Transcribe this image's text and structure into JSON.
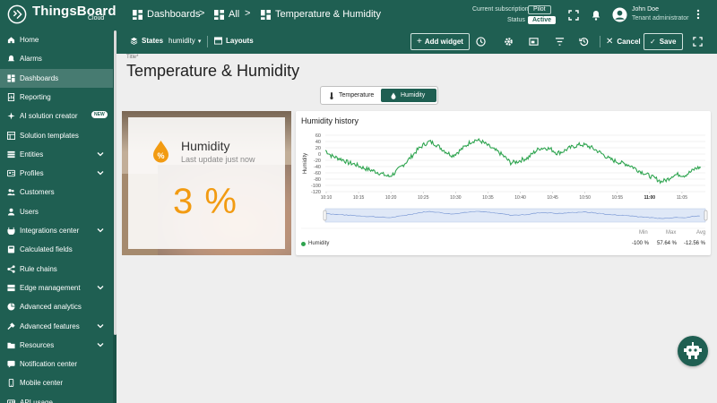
{
  "header": {
    "brand": "ThingsBoard",
    "brand_sub": "Cloud",
    "breadcrumb": [
      "Dashboards",
      "All",
      "Temperature & Humidity"
    ],
    "subscription_label": "Current subscription",
    "subscription_value": "Pilot",
    "status_label": "Status",
    "status_value": "Active",
    "user_name": "John Doe",
    "user_role": "Tenant administrator"
  },
  "sidebar": {
    "items": [
      {
        "label": "Home",
        "icon": "home-icon"
      },
      {
        "label": "Alarms",
        "icon": "alarm-icon"
      },
      {
        "label": "Dashboards",
        "icon": "dashboard-icon",
        "active": true
      },
      {
        "label": "Reporting",
        "icon": "report-icon"
      },
      {
        "label": "AI solution creator",
        "icon": "sparkle-icon",
        "badge": "NEW"
      },
      {
        "label": "Solution templates",
        "icon": "template-icon"
      },
      {
        "label": "Entities",
        "icon": "entities-icon",
        "expandable": true
      },
      {
        "label": "Profiles",
        "icon": "profiles-icon",
        "expandable": true
      },
      {
        "label": "Customers",
        "icon": "customers-icon"
      },
      {
        "label": "Users",
        "icon": "user-icon"
      },
      {
        "label": "Integrations center",
        "icon": "integrations-icon",
        "expandable": true
      },
      {
        "label": "Calculated fields",
        "icon": "calc-icon"
      },
      {
        "label": "Rule chains",
        "icon": "rule-chain-icon"
      },
      {
        "label": "Edge management",
        "icon": "edge-icon",
        "expandable": true
      },
      {
        "label": "Advanced analytics",
        "icon": "analytics-icon"
      },
      {
        "label": "Advanced features",
        "icon": "tools-icon",
        "expandable": true
      },
      {
        "label": "Resources",
        "icon": "folder-icon",
        "expandable": true
      },
      {
        "label": "Notification center",
        "icon": "notification-icon"
      },
      {
        "label": "Mobile center",
        "icon": "mobile-icon"
      },
      {
        "label": "API usage",
        "icon": "api-icon"
      }
    ]
  },
  "toolbar": {
    "states_label": "States",
    "states_value": "humidity",
    "layouts_label": "Layouts",
    "add_widget_label": "Add widget",
    "cancel_label": "Cancel",
    "save_label": "Save"
  },
  "dashboard": {
    "title_label": "Title*",
    "title": "Temperature & Humidity",
    "tabs": [
      {
        "label": "Temperature",
        "icon": "thermometer-icon",
        "active": false
      },
      {
        "label": "Humidity",
        "icon": "water-drop-icon",
        "active": true
      }
    ]
  },
  "humidity_card": {
    "title": "Humidity",
    "subtitle": "Last update just now",
    "value": "3 %",
    "accent_color": "#f29b12"
  },
  "chart_data": {
    "type": "line",
    "title": "Humidity history",
    "ylabel": "Humidity",
    "ylim": [
      -120,
      60
    ],
    "yticks": [
      60,
      40,
      20,
      0,
      -20,
      -40,
      -60,
      -80,
      -100,
      -120
    ],
    "xticks": [
      "10:10",
      "10:15",
      "10:20",
      "10:25",
      "10:30",
      "10:35",
      "10:40",
      "10:45",
      "10:50",
      "10:55",
      "11:00",
      "11:05"
    ],
    "xticks_bold": [
      "11:00"
    ],
    "x_start": "10:10",
    "x_end": "11:08",
    "series": [
      {
        "name": "Humidity",
        "color": "#2ea44f",
        "values": [
          12,
          -5,
          -12,
          -18,
          -28,
          -32,
          -40,
          -47,
          -52,
          -58,
          -65,
          -72,
          -60,
          -42,
          -25,
          -5,
          15,
          30,
          40,
          32,
          18,
          5,
          -5,
          8,
          22,
          38,
          45,
          40,
          28,
          15,
          5,
          -10,
          -28,
          -25,
          -18,
          -12,
          5,
          18,
          20,
          15,
          3,
          8,
          18,
          25,
          30,
          28,
          20,
          10,
          -2,
          -15,
          -22,
          -28,
          -32,
          -40,
          -52,
          -60,
          -70,
          -78,
          -88,
          -82,
          -68,
          -65,
          -68,
          -58,
          -45,
          -42
        ]
      }
    ],
    "stats": {
      "headers": [
        "Min",
        "Max",
        "Avg"
      ],
      "values": [
        "-100 %",
        "57.64 %",
        "-12.56 %"
      ]
    }
  }
}
